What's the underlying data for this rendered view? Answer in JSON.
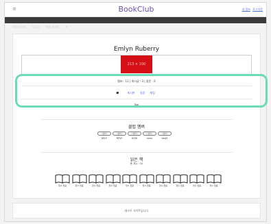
{
  "header": {
    "menu_icon": "≡",
    "brand": "BookClub",
    "auth": [
      "내 정보",
      "로그아웃"
    ]
  },
  "nav": {
    "items": [
      "모임 리스트",
      "독후감",
      "알림 리스트",
      "4"
    ]
  },
  "profile": {
    "name": "Emlyn Ruberry",
    "banner": {
      "label": "213 × 100",
      "color": "#d50f15"
    },
    "stats": "멤버 : 11 | 게시글 : 3 | 질문 : 0",
    "actions": {
      "star": "☻",
      "links": [
        "게시판",
        "일정",
        "채팅"
      ]
    },
    "owner": "Teal"
  },
  "members": {
    "title": "클럽 멤버",
    "items": [
      {
        "tag": "<멤버>",
        "name": "KELY"
      },
      {
        "tag": "<멤버>",
        "name": "RPVI"
      },
      {
        "tag": "<멤버>",
        "name": "UOSI"
      },
      {
        "tag": "<멤버>",
        "name": "xxxx"
      },
      {
        "tag": "<멤버>",
        "name": "test2"
      }
    ]
  },
  "books": {
    "title": "읽은 책",
    "count": "총 개수 : 10",
    "items": [
      {
        "caption": "정수 없음"
      },
      {
        "caption": "정수 없음"
      },
      {
        "caption": "정수 없음"
      },
      {
        "caption": "정수 없음"
      },
      {
        "caption": "정수 없음"
      },
      {
        "caption": "정수 없음"
      },
      {
        "caption": "정수 없음"
      },
      {
        "caption": "정수 없음"
      },
      {
        "caption": "정수 없음"
      },
      {
        "caption": "정수 없음"
      }
    ]
  },
  "footer": {
    "text": "테스트 사이트입니다"
  },
  "colors": {
    "brand": "#6b4fb0",
    "banner": "#d50f15",
    "highlight": "#6dd9b5",
    "nav_bg": "#3a3a3c"
  }
}
